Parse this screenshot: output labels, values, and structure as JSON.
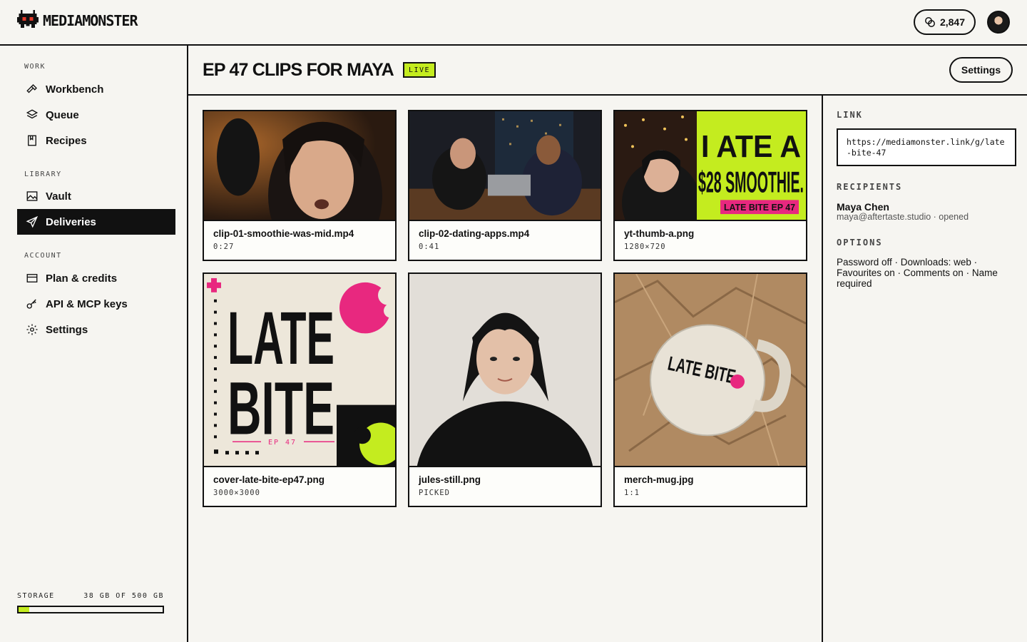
{
  "app": {
    "name": "MEDIAMONSTER",
    "credits": "2,847"
  },
  "sidebar": {
    "sections": [
      {
        "label": "WORK",
        "items": [
          {
            "label": "Workbench",
            "icon": "hammer-icon"
          },
          {
            "label": "Queue",
            "icon": "layers-icon"
          },
          {
            "label": "Recipes",
            "icon": "book-icon"
          }
        ]
      },
      {
        "label": "LIBRARY",
        "items": [
          {
            "label": "Vault",
            "icon": "image-icon"
          },
          {
            "label": "Deliveries",
            "icon": "send-icon",
            "active": true
          }
        ]
      },
      {
        "label": "ACCOUNT",
        "items": [
          {
            "label": "Plan & credits",
            "icon": "card-icon"
          },
          {
            "label": "API & MCP keys",
            "icon": "key-icon"
          },
          {
            "label": "Settings",
            "icon": "gear-icon"
          }
        ]
      }
    ],
    "storage": {
      "label": "STORAGE",
      "value": "38 GB OF 500 GB",
      "fraction": 0.076
    }
  },
  "header": {
    "title": "EP 47 CLIPS FOR MAYA",
    "badge": "LIVE",
    "settings_label": "Settings"
  },
  "assets": [
    {
      "name": "clip-01-smoothie-was-mid.mp4",
      "meta": "0:27"
    },
    {
      "name": "clip-02-dating-apps.mp4",
      "meta": "0:41"
    },
    {
      "name": "yt-thumb-a.png",
      "meta": "1280×720"
    },
    {
      "name": "cover-late-bite-ep47.png",
      "meta": "3000×3000"
    },
    {
      "name": "jules-still.png",
      "meta": "PICKED"
    },
    {
      "name": "merch-mug.jpg",
      "meta": "1:1"
    }
  ],
  "thumb_text": {
    "yt_line1": "I ATE A",
    "yt_line2": "$28 SMOOTHIE.",
    "yt_tag": "LATE BITE EP 47",
    "cover_line1": "LATE",
    "cover_line2": "BITE",
    "cover_ep": "EP 47",
    "mug_text": "LATE BITE"
  },
  "right_panel": {
    "link_label": "LINK",
    "link_url": "https://mediamonster.link/g/late-bite-47",
    "recipients_label": "RECIPIENTS",
    "recipient_name": "Maya Chen",
    "recipient_meta": "maya@aftertaste.studio · opened",
    "options_label": "OPTIONS",
    "options_text": "Password off · Downloads: web · Favourites on · Comments on · Name required"
  },
  "colors": {
    "accent": "#c4ec1f",
    "ink": "#111111",
    "paper": "#f6f5f1",
    "pink": "#e8287f"
  }
}
